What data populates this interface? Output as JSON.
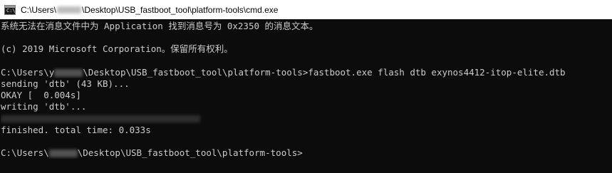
{
  "window": {
    "title_prefix": "C:\\Users\\",
    "title_suffix": "\\Desktop\\USB_fastboot_tool\\platform-tools\\cmd.exe",
    "icon_glyph": "C:\\",
    "icon": "cmd-icon"
  },
  "console": {
    "line1": "系统无法在消息文件中为 Application 找到消息号为 0x2350 的消息文本。",
    "line2": "",
    "line3": "(c) 2019 Microsoft Corporation。保留所有权利。",
    "line4": "",
    "prompt1_prefix": "C:\\Users\\y",
    "prompt1_suffix": "\\Desktop\\USB_fastboot_tool\\platform-tools>fastboot.exe flash dtb exynos4412-itop-elite.dtb",
    "line6": "sending 'dtb' (43 KB)...",
    "line7": "OKAY [  0.004s]",
    "line8": "writing 'dtb'...",
    "line10": "finished. total time: 0.033s",
    "line11": "",
    "prompt2_prefix": "C:\\Users\\",
    "prompt2_suffix": "\\Desktop\\USB_fastboot_tool\\platform-tools>"
  },
  "colors": {
    "background": "#0c0c0c",
    "foreground": "#cccccc",
    "titlebar": "#ffffff"
  }
}
